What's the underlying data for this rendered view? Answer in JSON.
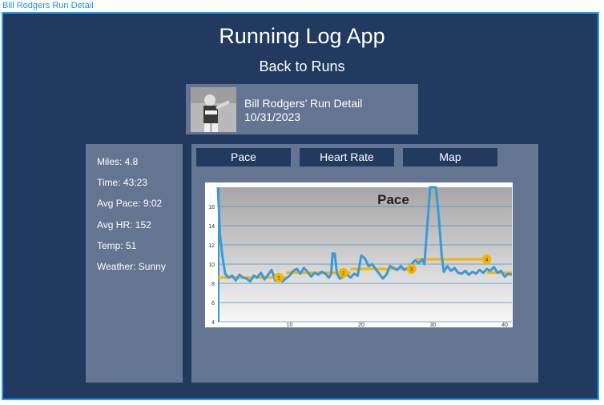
{
  "frame": {
    "label": "Bill Rodgers Run Detail"
  },
  "app": {
    "title": "Running Log App",
    "back_label": "Back to Runs"
  },
  "run": {
    "title": "Bill Rodgers’ Run Detail",
    "date": "10/31/2023"
  },
  "stats": [
    {
      "label": "Miles: 4.8"
    },
    {
      "label": "Time: 43:23"
    },
    {
      "label": "Avg Pace: 9:02"
    },
    {
      "label": "Avg HR: 152"
    },
    {
      "label": "Temp: 51"
    },
    {
      "label": "Weather: Sunny"
    }
  ],
  "tabs": [
    {
      "label": "Pace"
    },
    {
      "label": "Heart Rate"
    },
    {
      "label": "Map"
    }
  ],
  "colors": {
    "background": "#233a60",
    "panel": "#647591",
    "accent": "#2ca0f0",
    "pace_line": "#3a9ad8",
    "split_line": "#f5b400"
  },
  "chart_data": {
    "type": "line",
    "title": "Pace",
    "xlim": [
      0,
      41
    ],
    "ylim": [
      4,
      18
    ],
    "x_ticks": [
      10,
      20,
      30,
      40
    ],
    "y_ticks": [
      4,
      6,
      8,
      10,
      12,
      14,
      16
    ],
    "grid": true,
    "series": [
      {
        "values": [
          [
            0,
            18
          ],
          [
            0.3,
            13
          ],
          [
            0.6,
            11
          ],
          [
            1,
            9
          ],
          [
            1.5,
            8.6
          ],
          [
            2,
            8.8
          ],
          [
            2.5,
            8.3
          ],
          [
            3,
            8.9
          ],
          [
            3.5,
            8.6
          ],
          [
            4,
            8.5
          ],
          [
            4.5,
            8.2
          ],
          [
            5,
            8.8
          ],
          [
            5.5,
            8.6
          ],
          [
            6,
            9.1
          ],
          [
            6.5,
            8.4
          ],
          [
            7,
            8.9
          ],
          [
            7.5,
            9.4
          ],
          [
            8,
            8.3
          ],
          [
            8.5,
            8.6
          ],
          [
            9,
            8.2
          ],
          [
            9.5,
            8.5
          ],
          [
            10,
            8.8
          ],
          [
            10.5,
            9.3
          ],
          [
            11,
            9.5
          ],
          [
            11.5,
            9.0
          ],
          [
            12,
            9.6
          ],
          [
            12.5,
            9.2
          ],
          [
            13,
            8.7
          ],
          [
            13.5,
            9.1
          ],
          [
            14,
            8.9
          ],
          [
            14.5,
            9.2
          ],
          [
            15,
            9.0
          ],
          [
            15.5,
            8.6
          ],
          [
            15.8,
            9.0
          ],
          [
            16,
            11.1
          ],
          [
            16.3,
            11.1
          ],
          [
            16.6,
            9.0
          ],
          [
            17,
            8.5
          ],
          [
            17.5,
            8.7
          ],
          [
            18,
            8.9
          ],
          [
            18.5,
            8.6
          ],
          [
            19,
            9.0
          ],
          [
            19.5,
            8.8
          ],
          [
            20,
            10.9
          ],
          [
            20.5,
            10.6
          ],
          [
            21,
            9.8
          ],
          [
            21.5,
            10.0
          ],
          [
            22,
            9.5
          ],
          [
            22.5,
            9.0
          ],
          [
            23,
            8.5
          ],
          [
            23.5,
            8.9
          ],
          [
            24,
            9.8
          ],
          [
            24.5,
            9.6
          ],
          [
            25,
            9.4
          ],
          [
            25.5,
            9.8
          ],
          [
            26,
            9.4
          ],
          [
            26.5,
            9.6
          ],
          [
            27,
            10.0
          ],
          [
            27.5,
            10.4
          ],
          [
            28,
            10.1
          ],
          [
            28.5,
            10.5
          ],
          [
            28.8,
            10.0
          ],
          [
            29.2,
            14
          ],
          [
            29.6,
            18
          ],
          [
            30,
            18
          ],
          [
            30.4,
            18
          ],
          [
            30.8,
            15
          ],
          [
            31.2,
            11
          ],
          [
            31.5,
            9.2
          ],
          [
            32,
            9.8
          ],
          [
            32.5,
            9.3
          ],
          [
            33,
            9.6
          ],
          [
            33.5,
            9.1
          ],
          [
            34,
            9.0
          ],
          [
            34.5,
            9.3
          ],
          [
            35,
            8.9
          ],
          [
            35.5,
            9.2
          ],
          [
            36,
            9.0
          ],
          [
            36.5,
            9.4
          ],
          [
            37,
            9.1
          ],
          [
            37.5,
            9.5
          ],
          [
            38,
            9.3
          ],
          [
            38.5,
            9.7
          ],
          [
            39,
            9.1
          ],
          [
            39.5,
            9.3
          ],
          [
            40,
            8.7
          ],
          [
            40.5,
            9.0
          ],
          [
            41,
            8.9
          ]
        ]
      }
    ],
    "splits": [
      {
        "label": "1",
        "x_start": 0,
        "x_end": 9.5,
        "y": 8.6,
        "marker_x": 8.5
      },
      {
        "label": "2",
        "x_start": 9.5,
        "x_end": 18.5,
        "y": 9.1,
        "marker_x": 17.5
      },
      {
        "label": "3",
        "x_start": 18.5,
        "x_end": 27.5,
        "y": 9.5,
        "marker_x": 27
      },
      {
        "label": "4",
        "x_start": 27.5,
        "x_end": 37.5,
        "y": 10.5,
        "marker_x": 37.5
      },
      {
        "label": "",
        "x_start": 37.5,
        "x_end": 41,
        "y": 9.1,
        "marker_x": null
      }
    ]
  }
}
